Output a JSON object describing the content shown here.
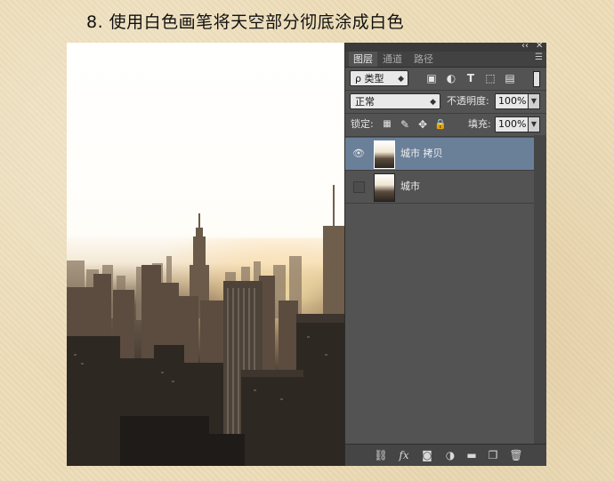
{
  "title": "8. 使用白色画笔将天空部分彻底涂成白色",
  "panel": {
    "header_controls": {
      "collapse": "‹‹",
      "close": "✕"
    },
    "tabs": [
      {
        "label": "图层",
        "active": true
      },
      {
        "label": "通道",
        "active": false
      },
      {
        "label": "路径",
        "active": false
      }
    ],
    "tab_menu_icon": "panel-menu-icon",
    "filter": {
      "kind_label": "ρ 类型",
      "icons": [
        "image-filter-icon",
        "adjustment-filter-icon",
        "type-filter-icon",
        "shape-filter-icon",
        "smart-object-filter-icon"
      ]
    },
    "blend_mode": "正常",
    "opacity_label": "不透明度:",
    "opacity_value": "100%",
    "lock_label": "锁定:",
    "fill_label": "填充:",
    "fill_value": "100%",
    "layers": [
      {
        "name": "城市 拷贝",
        "visible": true,
        "selected": true
      },
      {
        "name": "城市",
        "visible": false,
        "selected": false
      }
    ],
    "bottom_icons": [
      "link-icon",
      "fx-icon",
      "mask-icon",
      "adjustment-icon",
      "folder-icon",
      "new-layer-icon",
      "trash-icon"
    ],
    "selection_color": "#6a7f98"
  }
}
